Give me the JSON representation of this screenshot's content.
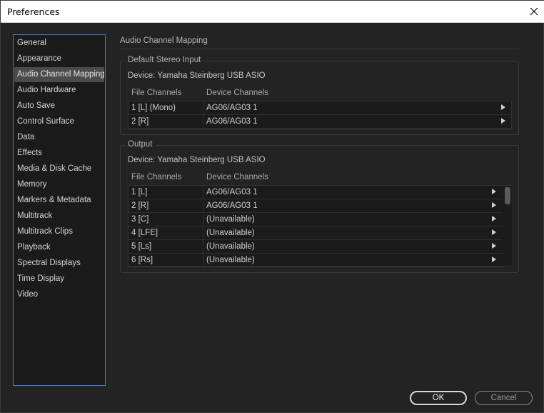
{
  "window": {
    "title": "Preferences"
  },
  "sidebar": {
    "items": [
      {
        "label": "General"
      },
      {
        "label": "Appearance"
      },
      {
        "label": "Audio Channel Mapping",
        "selected": true
      },
      {
        "label": "Audio Hardware"
      },
      {
        "label": "Auto Save"
      },
      {
        "label": "Control Surface"
      },
      {
        "label": "Data"
      },
      {
        "label": "Effects"
      },
      {
        "label": "Media & Disk Cache"
      },
      {
        "label": "Memory"
      },
      {
        "label": "Markers & Metadata"
      },
      {
        "label": "Multitrack"
      },
      {
        "label": "Multitrack Clips"
      },
      {
        "label": "Playback"
      },
      {
        "label": "Spectral Displays"
      },
      {
        "label": "Time Display"
      },
      {
        "label": "Video"
      }
    ]
  },
  "main": {
    "title": "Audio Channel Mapping",
    "input": {
      "legend": "Default Stereo Input",
      "device": "Device: Yamaha Steinberg USB ASIO",
      "col_file": "File Channels",
      "col_device": "Device Channels",
      "rows": [
        {
          "file": "1 [L] (Mono)",
          "device": "AG06/AG03 1"
        },
        {
          "file": "2 [R]",
          "device": "AG06/AG03 1"
        }
      ]
    },
    "output": {
      "legend": "Output",
      "device": "Device: Yamaha Steinberg USB ASIO",
      "col_file": "File Channels",
      "col_device": "Device Channels",
      "rows": [
        {
          "file": "1 [L]",
          "device": "AG06/AG03 1"
        },
        {
          "file": "2 [R]",
          "device": "AG06/AG03 1"
        },
        {
          "file": "3 [C]",
          "device": "(Unavailable)"
        },
        {
          "file": "4 [LFE]",
          "device": "(Unavailable)"
        },
        {
          "file": "5 [Ls]",
          "device": "(Unavailable)"
        },
        {
          "file": "6 [Rs]",
          "device": "(Unavailable)"
        }
      ]
    }
  },
  "buttons": {
    "ok": "OK",
    "cancel": "Cancel"
  },
  "colors": {
    "accent": "#3f7fc6",
    "selected_item": "#4b4b4b",
    "background": "#232323"
  }
}
